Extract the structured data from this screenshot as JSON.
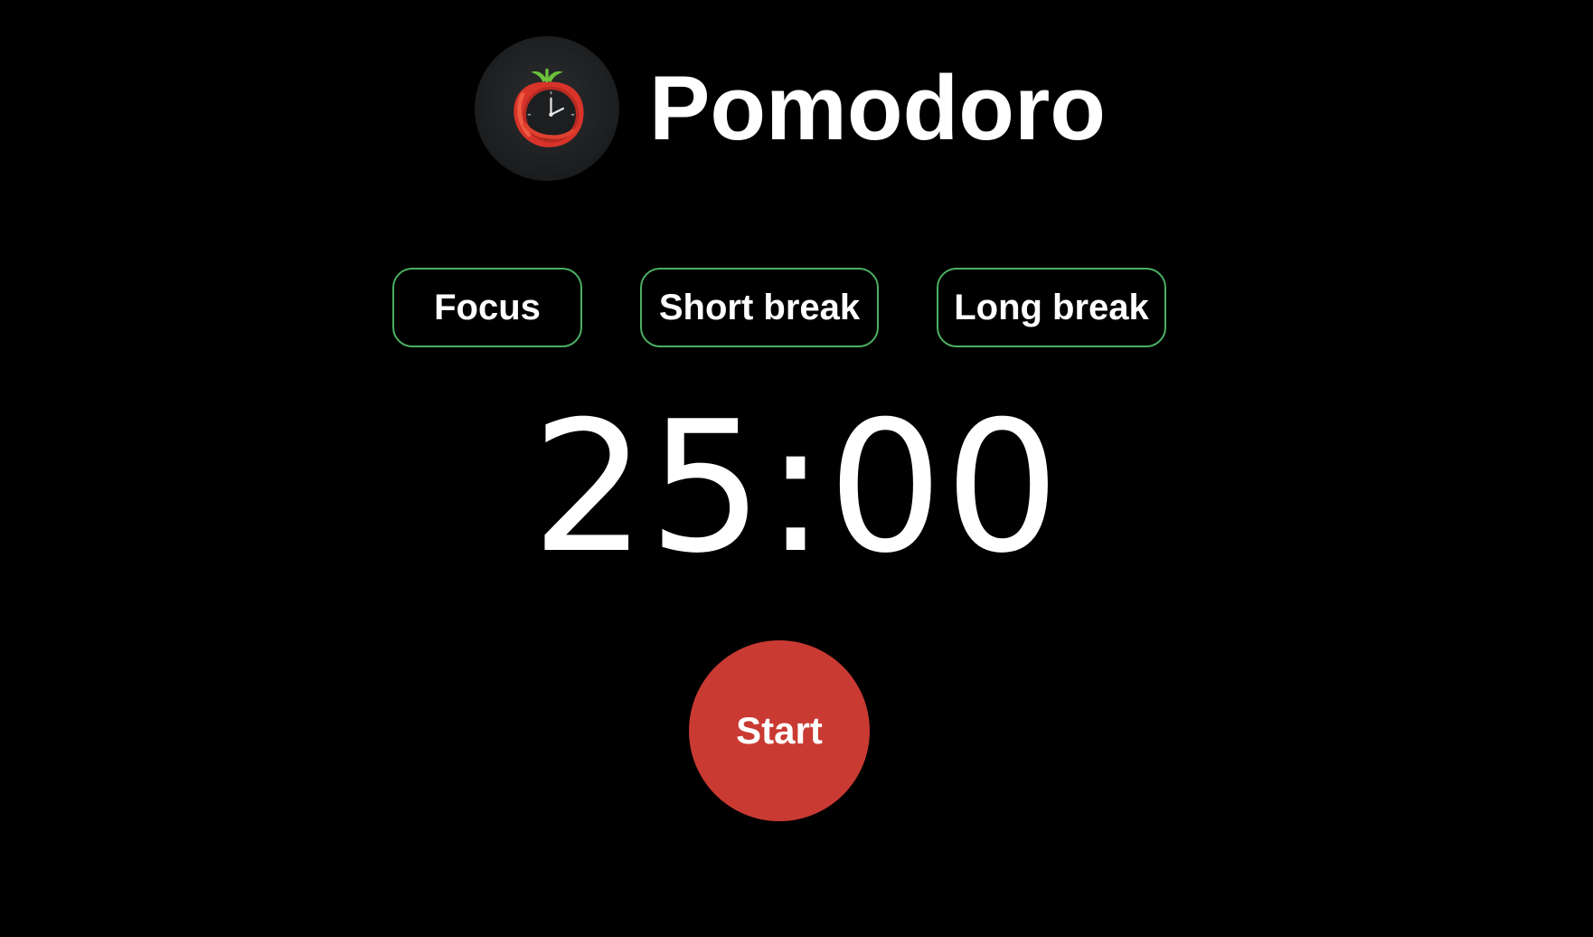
{
  "app": {
    "title": "Pomodoro",
    "logo_icon": "tomato-clock-icon"
  },
  "modes": [
    {
      "label": "Focus"
    },
    {
      "label": "Short break"
    },
    {
      "label": "Long break"
    }
  ],
  "timer": {
    "display": "25:00"
  },
  "controls": {
    "start_label": "Start"
  },
  "colors": {
    "background": "#000000",
    "tab_border": "#4caf62",
    "start_button": "#c93a32",
    "text": "#ffffff"
  }
}
